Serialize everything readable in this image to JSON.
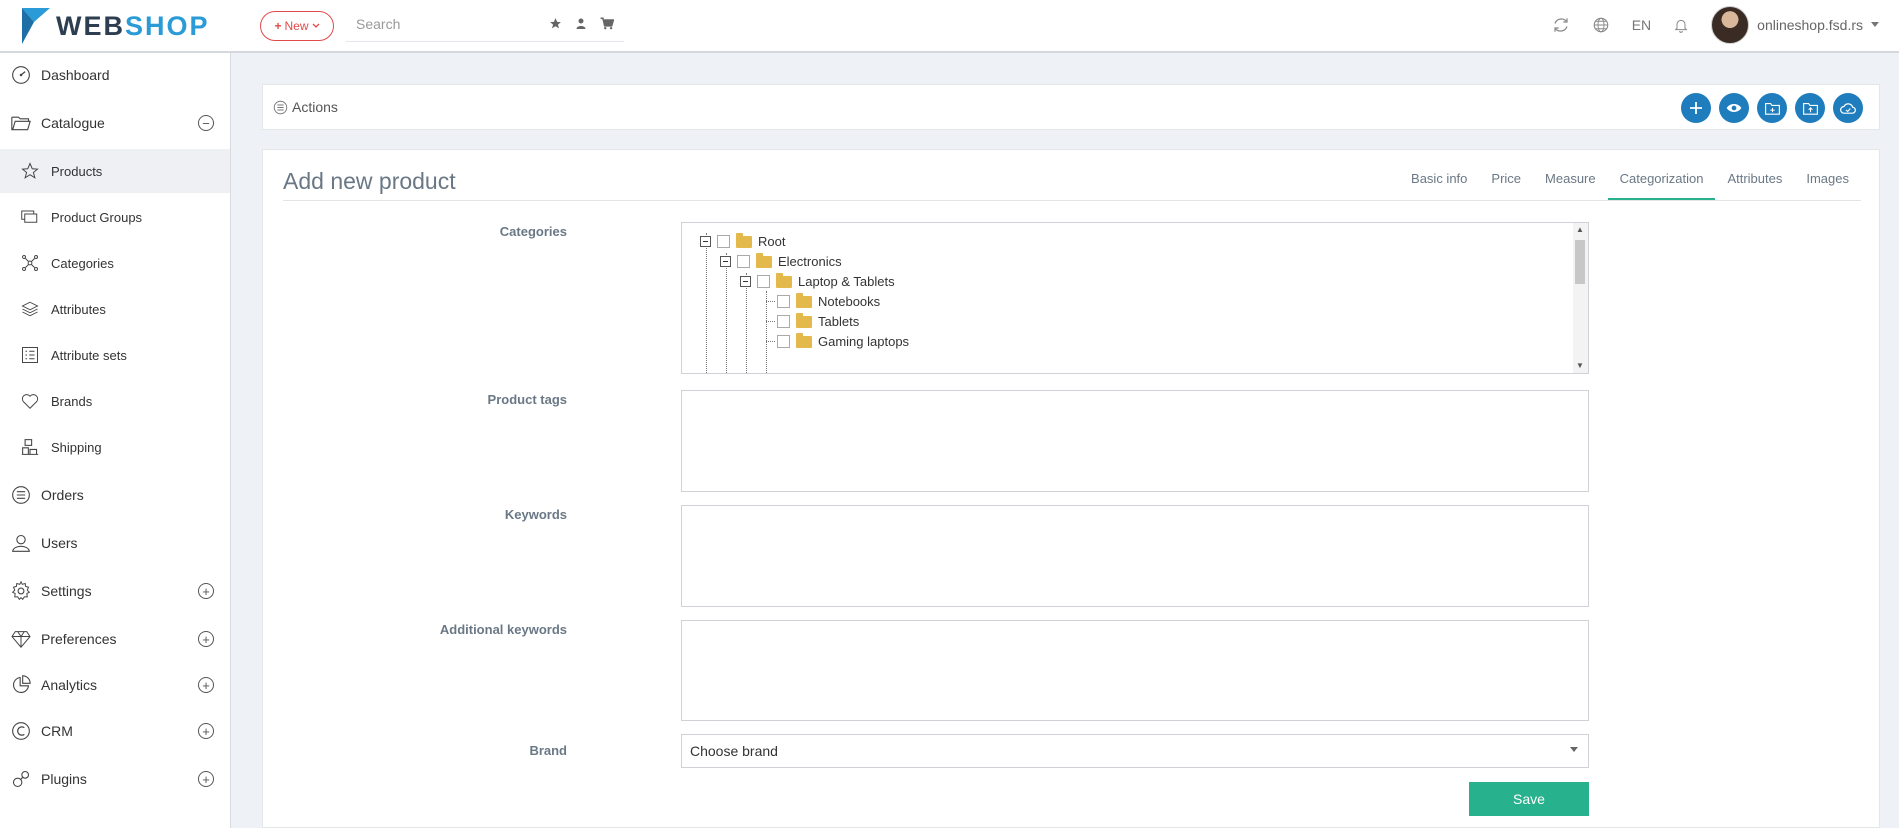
{
  "header": {
    "logo_web": "WEB",
    "logo_shop": "SHOP",
    "new_button": "New",
    "search_placeholder": "Search",
    "language": "EN",
    "user_name": "onlineshop.fsd.rs"
  },
  "sidebar": {
    "items": [
      {
        "label": "Dashboard",
        "icon": "dashboard-icon"
      },
      {
        "label": "Catalogue",
        "icon": "folder-open-icon",
        "toggle": "−"
      },
      {
        "label": "Products",
        "icon": "star-icon"
      },
      {
        "label": "Product Groups",
        "icon": "product-groups-icon"
      },
      {
        "label": "Categories",
        "icon": "categories-icon"
      },
      {
        "label": "Attributes",
        "icon": "layers-icon"
      },
      {
        "label": "Attribute sets",
        "icon": "list-icon"
      },
      {
        "label": "Brands",
        "icon": "heart-icon"
      },
      {
        "label": "Shipping",
        "icon": "shipping-icon"
      },
      {
        "label": "Orders",
        "icon": "orders-icon"
      },
      {
        "label": "Users",
        "icon": "user-icon"
      },
      {
        "label": "Settings",
        "icon": "gear-icon",
        "toggle": "+"
      },
      {
        "label": "Preferences",
        "icon": "diamond-icon",
        "toggle": "+"
      },
      {
        "label": "Analytics",
        "icon": "pie-chart-icon",
        "toggle": "+"
      },
      {
        "label": "CRM",
        "icon": "crm-icon",
        "toggle": "+"
      },
      {
        "label": "Plugins",
        "icon": "plugins-icon",
        "toggle": "+"
      }
    ]
  },
  "actions": {
    "label": "Actions",
    "buttons": [
      "add-icon",
      "preview-icon",
      "folder-icon",
      "folder-upload-icon",
      "cloud-save-icon"
    ]
  },
  "main": {
    "title": "Add new product",
    "tabs": [
      "Basic info",
      "Price",
      "Measure",
      "Categorization",
      "Attributes",
      "Images"
    ],
    "active_tab": "Categorization",
    "fields": {
      "categories_label": "Categories",
      "product_tags_label": "Product tags",
      "keywords_label": "Keywords",
      "additional_keywords_label": "Additional keywords",
      "brand_label": "Brand",
      "brand_value": "Choose brand"
    },
    "tree": [
      "Root",
      "Electronics",
      "Laptop & Tablets",
      "Notebooks",
      "Tablets",
      "Gaming laptops"
    ],
    "save_button": "Save"
  },
  "colors": {
    "brand_blue": "#1f7dbd",
    "accent_green": "#27b18d",
    "new_red": "#e14a4a",
    "folder_yellow": "#e3b94c"
  }
}
